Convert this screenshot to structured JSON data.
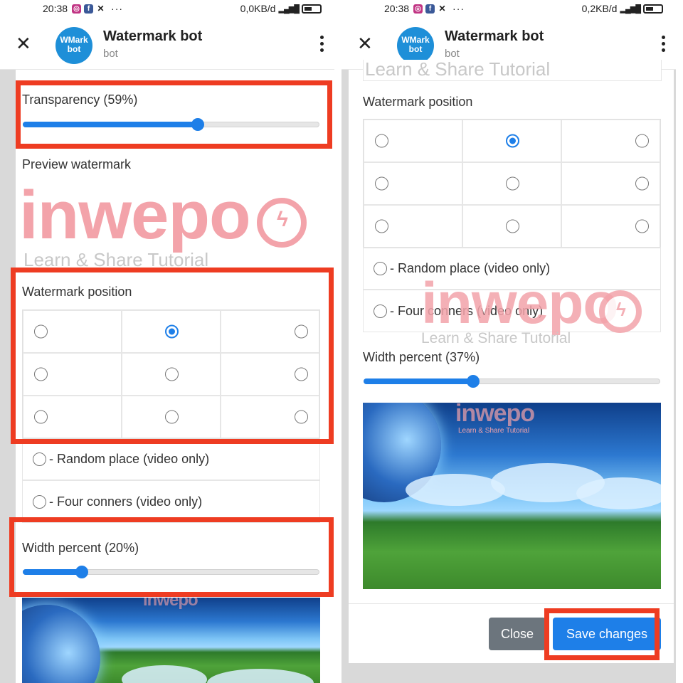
{
  "status": {
    "time": "20:38",
    "left_speed": "0,0KB/d",
    "right_speed": "0,2KB/d",
    "network": "4G"
  },
  "header": {
    "title": "Watermark bot",
    "subtitle": "bot",
    "avatar_text_line1": "WMark",
    "avatar_text_line2": "bot"
  },
  "left": {
    "transparency_label": "Transparency (59%)",
    "transparency_value": 0.59,
    "preview_label": "Preview watermark",
    "position_label": "Watermark position",
    "random_label": "- Random place (video only)",
    "corners_label": "- Four conners (video only)",
    "width_label": "Width percent (20%)",
    "width_value": 0.2
  },
  "right": {
    "position_label": "Watermark position",
    "random_label": "- Random place (video only)",
    "corners_label": "- Four conners (video only)",
    "width_label": "Width percent (37%)",
    "width_value": 0.37,
    "close_label": "Close",
    "save_label": "Save changes"
  },
  "watermark": {
    "brand": "inwepo",
    "tagline": "Learn & Share Tutorial"
  },
  "selected_position": "top-center",
  "colors": {
    "accent": "#1e7fe8",
    "highlight": "#ee3c22",
    "watermark": "#f3a3aa",
    "close_button": "#6c757d"
  }
}
